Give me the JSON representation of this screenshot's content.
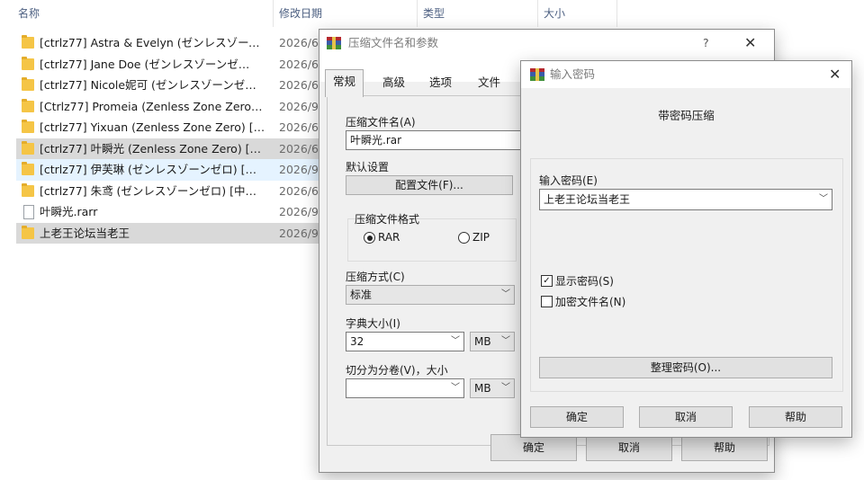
{
  "explorer": {
    "columns": {
      "name": "名称",
      "date": "修改日期",
      "type": "类型",
      "size": "大小"
    },
    "rows": [
      {
        "name": "[ctrlz77] Astra & Evelyn (ゼンレスゾーン…",
        "date": "2026/6",
        "icon": "folder-icon"
      },
      {
        "name": "[ctrlz77] Jane Doe (ゼンレスゾーンゼ…",
        "date": "2026/6",
        "icon": "folder-icon"
      },
      {
        "name": "[ctrlz77] Nicole妮可 (ゼンレスゾーンゼ…",
        "date": "2026/6",
        "icon": "folder-icon"
      },
      {
        "name": "[Ctrlz77] Promeia (Zenless Zone Zero…",
        "date": "2026/9",
        "icon": "folder-icon"
      },
      {
        "name": "[ctrlz77] Yixuan (Zenless Zone Zero) […",
        "date": "2026/6",
        "icon": "folder-icon"
      },
      {
        "name": "[ctrlz77] 叶瞬光 (Zenless Zone Zero) […",
        "date": "2026/6",
        "icon": "folder-icon"
      },
      {
        "name": "[ctrlz77] 伊芙琳 (ゼンレスゾーンゼロ) […",
        "date": "2026/9",
        "icon": "folder-icon"
      },
      {
        "name": "[ctrlz77] 朱鸢 (ゼンレスゾーンゼロ) [中…",
        "date": "2026/6",
        "icon": "folder-icon"
      },
      {
        "name": "叶瞬光.rarr",
        "date": "2026/9",
        "icon": "doc-icon"
      },
      {
        "name": "上老王论坛当老王",
        "date": "2026/9",
        "icon": "folder-icon"
      }
    ]
  },
  "main_dialog": {
    "title": "压缩文件名和参数",
    "help": "?",
    "close": "✕",
    "tabs": [
      "常规",
      "高级",
      "选项",
      "文件"
    ],
    "archive_name_label": "压缩文件名(A)",
    "archive_name_value": "叶瞬光.rar",
    "default_settings_label": "默认设置",
    "profiles_button": "配置文件(F)...",
    "format_group_label": "压缩文件格式",
    "format_rar": "RAR",
    "format_zip": "ZIP",
    "method_label": "压缩方式(C)",
    "method_value": "标准",
    "dict_label": "字典大小(I)",
    "dict_value": "32",
    "dict_unit": "MB",
    "split_label": "切分为分卷(V)，大小",
    "split_value": "",
    "split_unit": "MB",
    "ok": "确定",
    "cancel": "取消",
    "help_button": "帮助"
  },
  "password_dialog": {
    "title": "输入密码",
    "close": "✕",
    "heading": "带密码压缩",
    "enter_label": "输入密码(E)",
    "password_value": "上老王论坛当老王",
    "show_password": "显示密码(S)",
    "show_password_checked": true,
    "encrypt_names": "加密文件名(N)",
    "encrypt_names_checked": false,
    "organize_button": "整理密码(O)...",
    "ok": "确定",
    "cancel": "取消",
    "help_button": "帮助"
  },
  "colors": {
    "folder": "#f5c546",
    "selection": "#d9d9d9",
    "hover": "#e5f3ff",
    "dialog_bg": "#f0f0f0"
  }
}
